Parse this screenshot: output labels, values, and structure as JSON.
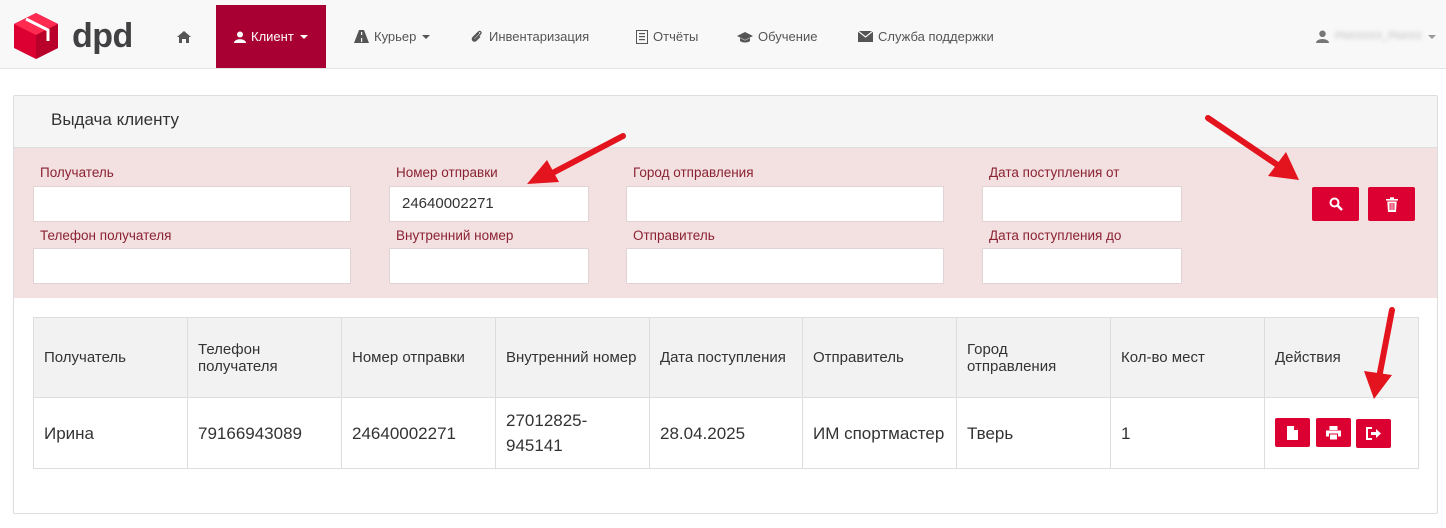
{
  "brand": {
    "name": "dpd",
    "accent": "#dc0032",
    "nav_active": "#a90034"
  },
  "nav": {
    "home_icon": "home-icon",
    "client": "Клиент",
    "courier": "Курьер",
    "inventory": "Инвентаризация",
    "reports": "Отчёты",
    "training": "Обучение",
    "support": "Служба поддержки",
    "user": "PNXXXXX_PNXXX"
  },
  "panel": {
    "title": "Выдача клиенту"
  },
  "filters": {
    "recipient": {
      "label": "Получатель",
      "value": ""
    },
    "recipient_phone": {
      "label": "Телефон получателя",
      "value": ""
    },
    "shipment_number": {
      "label": "Номер отправки",
      "value": "24640002271"
    },
    "internal_number": {
      "label": "Внутренний номер",
      "value": ""
    },
    "origin_city": {
      "label": "Город отправления",
      "value": ""
    },
    "sender": {
      "label": "Отправитель",
      "value": ""
    },
    "date_from": {
      "label": "Дата поступления от",
      "value": ""
    },
    "date_to": {
      "label": "Дата поступления до",
      "value": ""
    }
  },
  "table": {
    "headers": [
      "Получатель",
      "Телефон получателя",
      "Номер отправки",
      "Внутренний номер",
      "Дата поступления",
      "Отправитель",
      "Город отправления",
      "Кол-во мест",
      "Действия"
    ],
    "rows": [
      [
        "Ирина",
        "79166943089",
        "24640002271",
        "27012825-945141",
        "28.04.2025",
        "ИМ спортмастер",
        "Тверь",
        "1"
      ]
    ]
  }
}
